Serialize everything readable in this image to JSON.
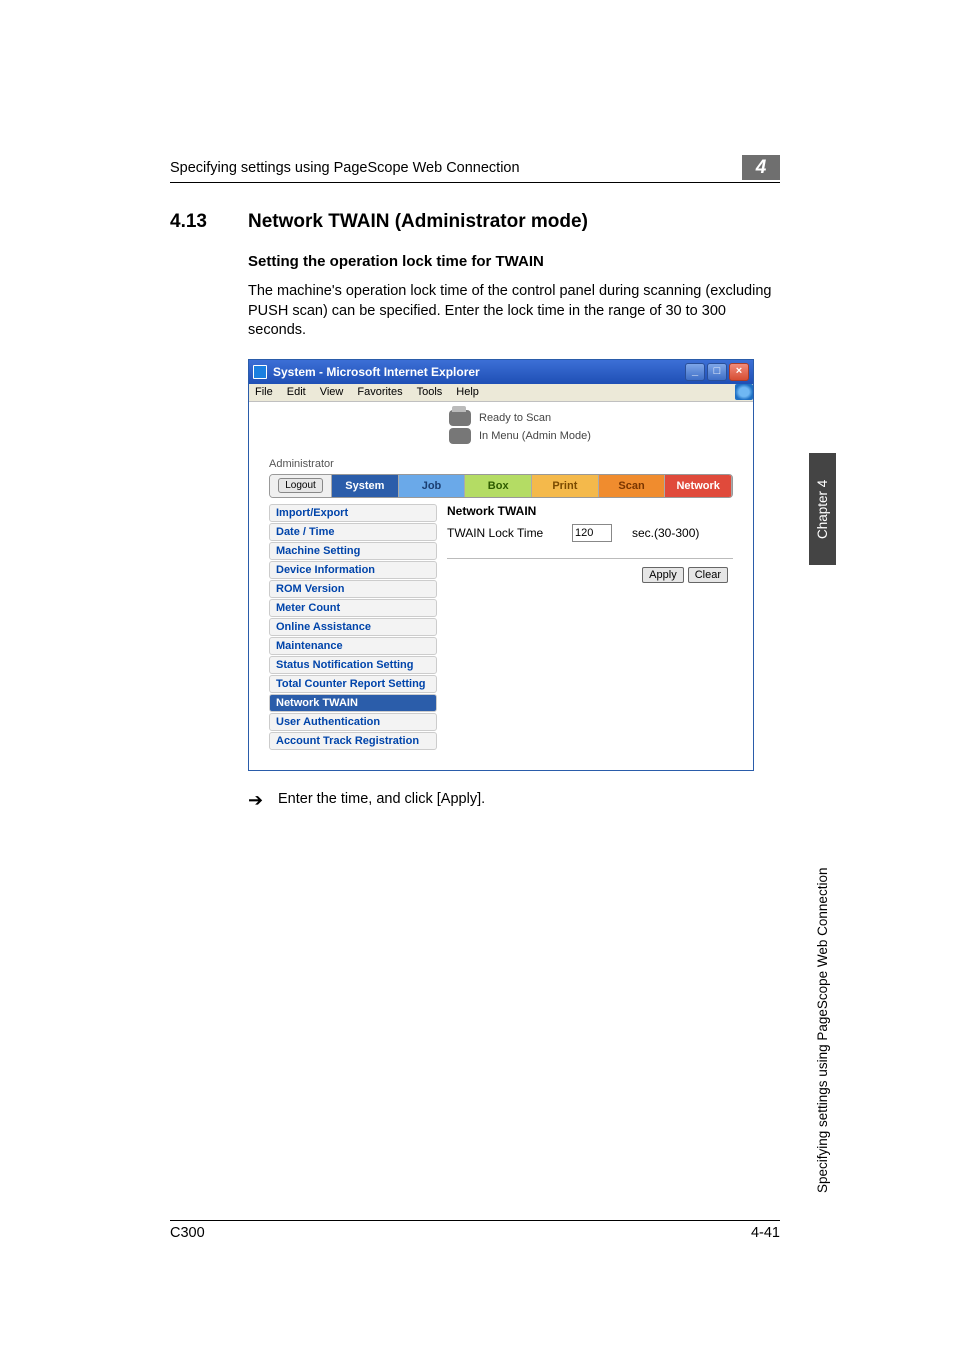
{
  "header": {
    "running_title": "Specifying settings using PageScope Web Connection",
    "chapter_num": "4"
  },
  "section": {
    "number": "4.13",
    "title": "Network TWAIN (Administrator mode)",
    "subtitle": "Setting the operation lock time for TWAIN",
    "body": "The machine's operation lock time of the control panel during scanning (excluding PUSH scan) can be specified. Enter the lock time in the range of 30 to 300 seconds."
  },
  "window": {
    "title": "System - Microsoft Internet Explorer",
    "menus": [
      "File",
      "Edit",
      "View",
      "Favorites",
      "Tools",
      "Help"
    ],
    "status1": "Ready to Scan",
    "status2": "In Menu (Admin Mode)",
    "admin_label": "Administrator",
    "logout": "Logout",
    "tabs": {
      "system": "System",
      "job": "Job",
      "box": "Box",
      "print": "Print",
      "scan": "Scan",
      "network": "Network"
    },
    "sidebar": [
      "Import/Export",
      "Date / Time",
      "Machine Setting",
      "Device Information",
      "ROM Version",
      "Meter Count",
      "Online Assistance",
      "Maintenance",
      "Status Notification Setting",
      "Total Counter Report Setting",
      "Network TWAIN",
      "User Authentication",
      "Account Track Registration"
    ],
    "sidebar_active_index": 10,
    "pane": {
      "title": "Network TWAIN",
      "field_label": "TWAIN Lock Time",
      "field_value": "120",
      "field_suffix": "sec.(30-300)",
      "apply": "Apply",
      "clear": "Clear"
    }
  },
  "after_screenshot": {
    "arrow": "➔",
    "text": "Enter the time, and click [Apply]."
  },
  "side_tab": "Chapter 4",
  "side_caption": "Specifying settings using PageScope Web Connection",
  "footer": {
    "left": "C300",
    "right": "4-41"
  },
  "chart_data": null
}
